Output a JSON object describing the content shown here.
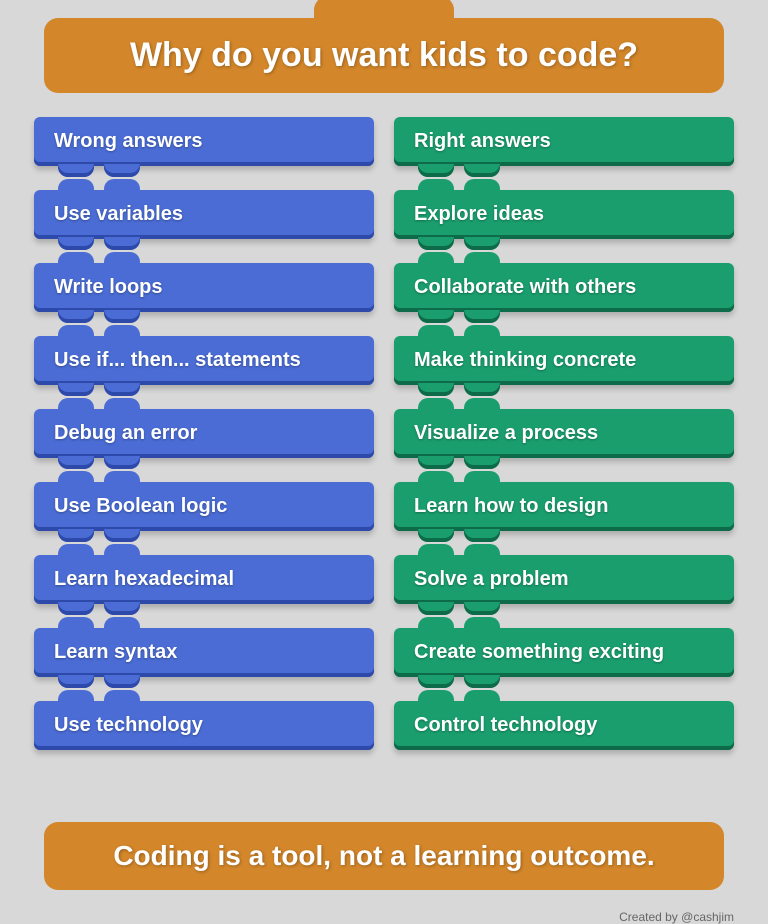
{
  "header": {
    "bump_decoration": true,
    "title": "Why do you want kids to code?"
  },
  "left_column": {
    "items": [
      {
        "label": "Wrong answers",
        "color": "blue"
      },
      {
        "label": "Use variables",
        "color": "blue"
      },
      {
        "label": "Write loops",
        "color": "blue"
      },
      {
        "label": "Use if... then... statements",
        "color": "blue"
      },
      {
        "label": "Debug an error",
        "color": "blue"
      },
      {
        "label": "Use Boolean logic",
        "color": "blue"
      },
      {
        "label": "Learn hexadecimal",
        "color": "blue"
      },
      {
        "label": "Learn syntax",
        "color": "blue"
      },
      {
        "label": "Use technology",
        "color": "blue"
      }
    ]
  },
  "right_column": {
    "items": [
      {
        "label": "Right answers",
        "color": "green"
      },
      {
        "label": "Explore ideas",
        "color": "green"
      },
      {
        "label": "Collaborate with others",
        "color": "green"
      },
      {
        "label": "Make thinking concrete",
        "color": "green"
      },
      {
        "label": "Visualize a process",
        "color": "green"
      },
      {
        "label": "Learn how to design",
        "color": "green"
      },
      {
        "label": "Solve a problem",
        "color": "green"
      },
      {
        "label": "Create something exciting",
        "color": "green"
      },
      {
        "label": "Control technology",
        "color": "green"
      }
    ]
  },
  "footer": {
    "text": "Coding is a tool, not a learning outcome."
  },
  "credit": {
    "text": "Created by @cashjim"
  },
  "colors": {
    "blue": "#4a6cd4",
    "blue_shadow": "#2d4aaa",
    "green": "#1a9e6e",
    "green_shadow": "#0d6b49",
    "orange": "#d4872a",
    "background": "#d8d8d8"
  }
}
